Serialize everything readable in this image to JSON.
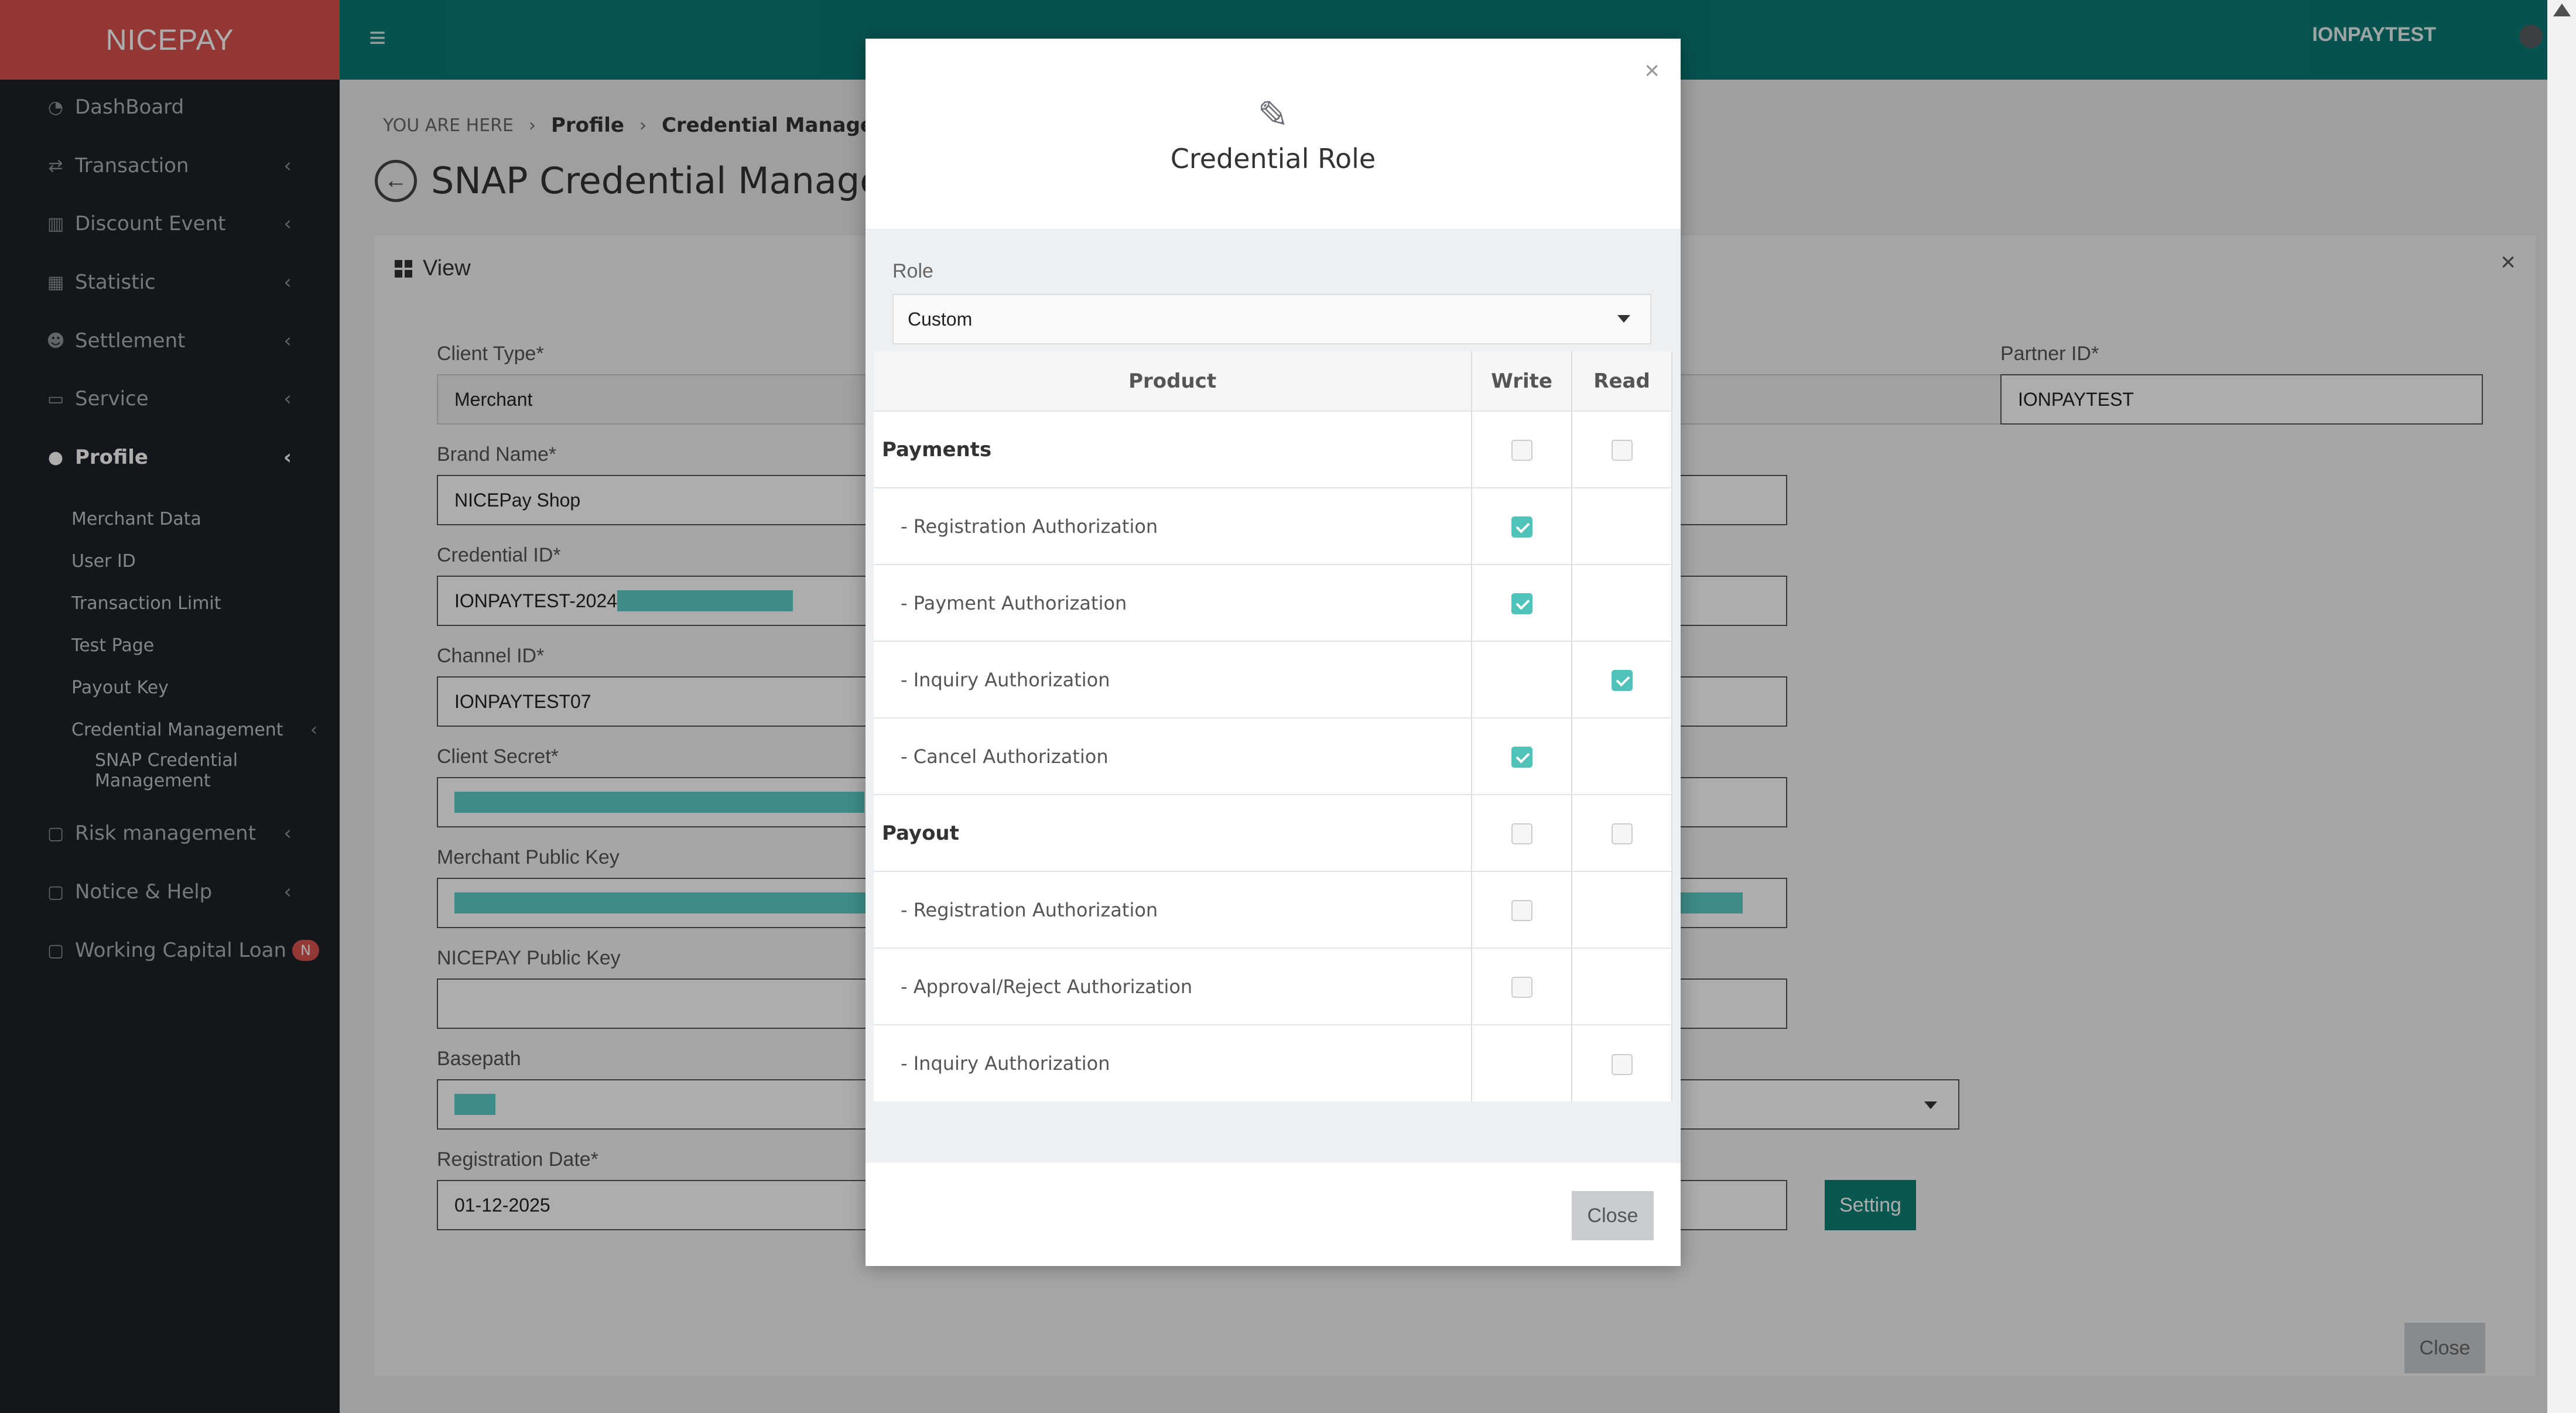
{
  "app": {
    "brand": "NICEPAY",
    "user": "IONPAYTEST"
  },
  "sidebar": {
    "items": [
      {
        "label": "DashBoard",
        "icon": "dashboard-icon",
        "has_chevron": false
      },
      {
        "label": "Transaction",
        "icon": "exchange-icon",
        "has_chevron": true
      },
      {
        "label": "Discount Event",
        "icon": "bar-chart-icon",
        "has_chevron": true
      },
      {
        "label": "Statistic",
        "icon": "calendar-icon",
        "has_chevron": true
      },
      {
        "label": "Settlement",
        "icon": "users-icon",
        "has_chevron": true
      },
      {
        "label": "Service",
        "icon": "monitor-icon",
        "has_chevron": true
      },
      {
        "label": "Profile",
        "icon": "comment-icon",
        "has_chevron": true,
        "active": true
      }
    ],
    "profile_sub": [
      "Merchant Data",
      "User ID",
      "Transaction Limit",
      "Test Page",
      "Payout Key",
      "Credential Management",
      "SNAP Credential Management"
    ],
    "bottom_items": [
      {
        "label": "Risk management",
        "icon": "folder-icon"
      },
      {
        "label": "Notice & Help",
        "icon": "folder-icon"
      },
      {
        "label": "Working Capital Loan",
        "icon": "folder-icon",
        "badge": "N"
      }
    ]
  },
  "breadcrumb": {
    "prefix": "YOU ARE HERE",
    "items": [
      "Profile",
      "Credential Managemen"
    ]
  },
  "page": {
    "title": "SNAP Credential Management"
  },
  "panel": {
    "title": "View",
    "fields": [
      {
        "label": "Client Type*",
        "value": "Merchant"
      },
      {
        "label": "Brand Name*",
        "value": "NICEPay Shop"
      },
      {
        "label": "Credential ID*",
        "value": "IONPAYTEST-2024"
      },
      {
        "label": "Channel ID*",
        "value": "IONPAYTEST07"
      },
      {
        "label": "Client Secret*",
        "value": ""
      },
      {
        "label": "Merchant Public Key",
        "value": ""
      },
      {
        "label": "NICEPAY Public Key",
        "value": ""
      },
      {
        "label": "Basepath",
        "value": ""
      },
      {
        "label": "Registration Date*",
        "value": "01-12-2025"
      }
    ],
    "partner_label": "Partner ID*",
    "partner_value": "IONPAYTEST",
    "setting_label": "Setting",
    "close_label": "Close"
  },
  "modal": {
    "title": "Credential Role",
    "role_label": "Role",
    "role_value": "Custom",
    "columns": {
      "product": "Product",
      "write": "Write",
      "read": "Read"
    },
    "rows": [
      {
        "label": "Payments",
        "group": true,
        "write": "off",
        "read": "off"
      },
      {
        "label": "- Registration Authorization",
        "group": false,
        "write": "on",
        "read": "none"
      },
      {
        "label": "- Payment Authorization",
        "group": false,
        "write": "on",
        "read": "none"
      },
      {
        "label": "- Inquiry Authorization",
        "group": false,
        "write": "none",
        "read": "on"
      },
      {
        "label": "- Cancel Authorization",
        "group": false,
        "write": "on",
        "read": "none"
      },
      {
        "label": "Payout",
        "group": true,
        "write": "off",
        "read": "off"
      },
      {
        "label": "- Registration Authorization",
        "group": false,
        "write": "off",
        "read": "none"
      },
      {
        "label": "- Approval/Reject Authorization",
        "group": false,
        "write": "off",
        "read": "none"
      },
      {
        "label": "- Inquiry Authorization",
        "group": false,
        "write": "none",
        "read": "off"
      }
    ],
    "close_label": "Close"
  },
  "colors": {
    "brand": "#d9534f",
    "topbar": "#0a7a73",
    "sidebar": "#1c2127",
    "accent": "#4fc3b9"
  }
}
